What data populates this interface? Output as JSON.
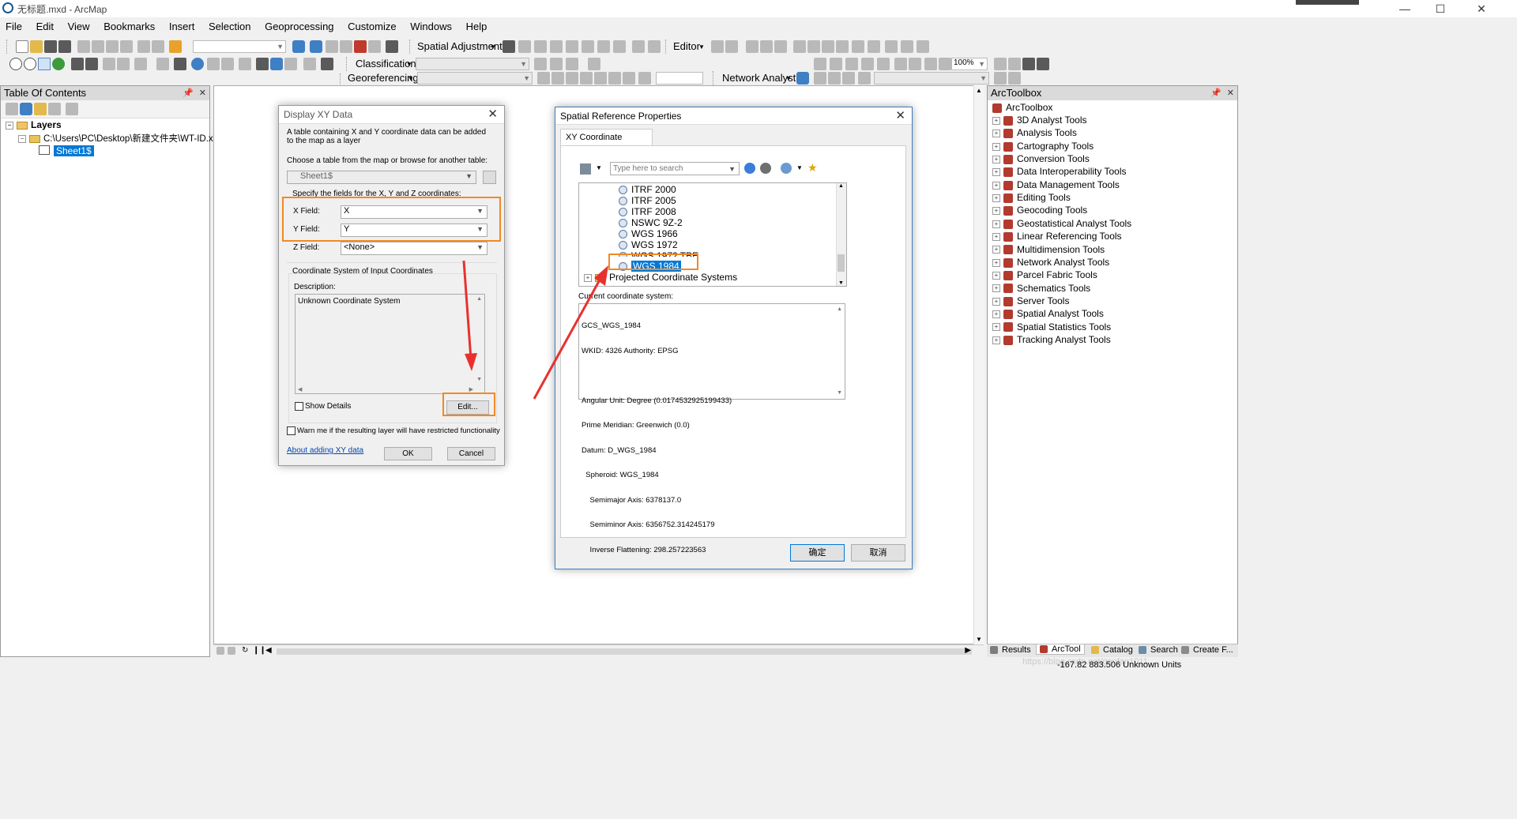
{
  "window": {
    "title": "无标题.mxd - ArcMap",
    "minimize": "—",
    "maximize": "☐",
    "close": "✕"
  },
  "menu": [
    "File",
    "Edit",
    "View",
    "Bookmarks",
    "Insert",
    "Selection",
    "Geoprocessing",
    "Customize",
    "Windows",
    "Help"
  ],
  "toolbars": {
    "spatial_adjustment": "Spatial Adjustment",
    "editor": "Editor",
    "classification": "Classification",
    "georeferencing": "Georeferencing",
    "network_analyst": "Network Analyst",
    "zoom_level": "100%"
  },
  "toc": {
    "title": "Table Of Contents",
    "layers": "Layers",
    "path": "C:\\Users\\PC\\Desktop\\新建文件夹\\WT-ID.xlsx",
    "sheet": "Sheet1$"
  },
  "display_xy": {
    "title": "Display XY Data",
    "intro": "A table containing X and Y coordinate data can be added to the map as a layer",
    "choose": "Choose a table from the map or browse for another table:",
    "table_value": "Sheet1$",
    "specify": "Specify the fields for the X, Y and Z coordinates:",
    "x_label": "X Field:",
    "x_value": "X",
    "y_label": "Y Field:",
    "y_value": "Y",
    "z_label": "Z Field:",
    "z_value": "<None>",
    "coord_group": "Coordinate System of Input Coordinates",
    "desc_label": "Description:",
    "desc_value": "Unknown Coordinate System",
    "show_details": "Show Details",
    "edit": "Edit...",
    "warn": "Warn me if the resulting layer will have restricted functionality",
    "about": "About adding XY data",
    "ok": "OK",
    "cancel": "Cancel"
  },
  "spatial_ref": {
    "title": "Spatial Reference Properties",
    "tab": "XY Coordinate System",
    "search_placeholder": "Type here to search",
    "items": [
      "ITRF 2000",
      "ITRF 2005",
      "ITRF 2008",
      "NSWC 9Z-2",
      "WGS 1966",
      "WGS 1972",
      "WGS 1972 TBE",
      "WGS 1984"
    ],
    "projected": "Projected Coordinate Systems",
    "current_label": "Current coordinate system:",
    "current_lines": [
      "GCS_WGS_1984",
      "WKID: 4326 Authority: EPSG",
      "",
      "Angular Unit: Degree (0.0174532925199433)",
      "Prime Meridian: Greenwich (0.0)",
      "Datum: D_WGS_1984",
      "  Spheroid: WGS_1984",
      "    Semimajor Axis: 6378137.0",
      "    Semiminor Axis: 6356752.314245179",
      "    Inverse Flattening: 298.257223563"
    ],
    "ok": "确定",
    "cancel": "取消"
  },
  "arctoolbox": {
    "title": "ArcToolbox",
    "root": "ArcToolbox",
    "tools": [
      "3D Analyst Tools",
      "Analysis Tools",
      "Cartography Tools",
      "Conversion Tools",
      "Data Interoperability Tools",
      "Data Management Tools",
      "Editing Tools",
      "Geocoding Tools",
      "Geostatistical Analyst Tools",
      "Linear Referencing Tools",
      "Multidimension Tools",
      "Network Analyst Tools",
      "Parcel Fabric Tools",
      "Schematics Tools",
      "Server Tools",
      "Spatial Analyst Tools",
      "Spatial Statistics Tools",
      "Tracking Analyst Tools"
    ]
  },
  "bottom_tabs": [
    "Results",
    "ArcTool",
    "Catalog",
    "Search",
    "Create F..."
  ],
  "status": {
    "coords": "-167.82  883.506 Unknown Units",
    "watermark": "https://blog.csdn.net/ganfan1011"
  },
  "colors": {
    "highlight": "#f08a24",
    "arrow": "#e8312f",
    "selection": "#0078d7"
  }
}
